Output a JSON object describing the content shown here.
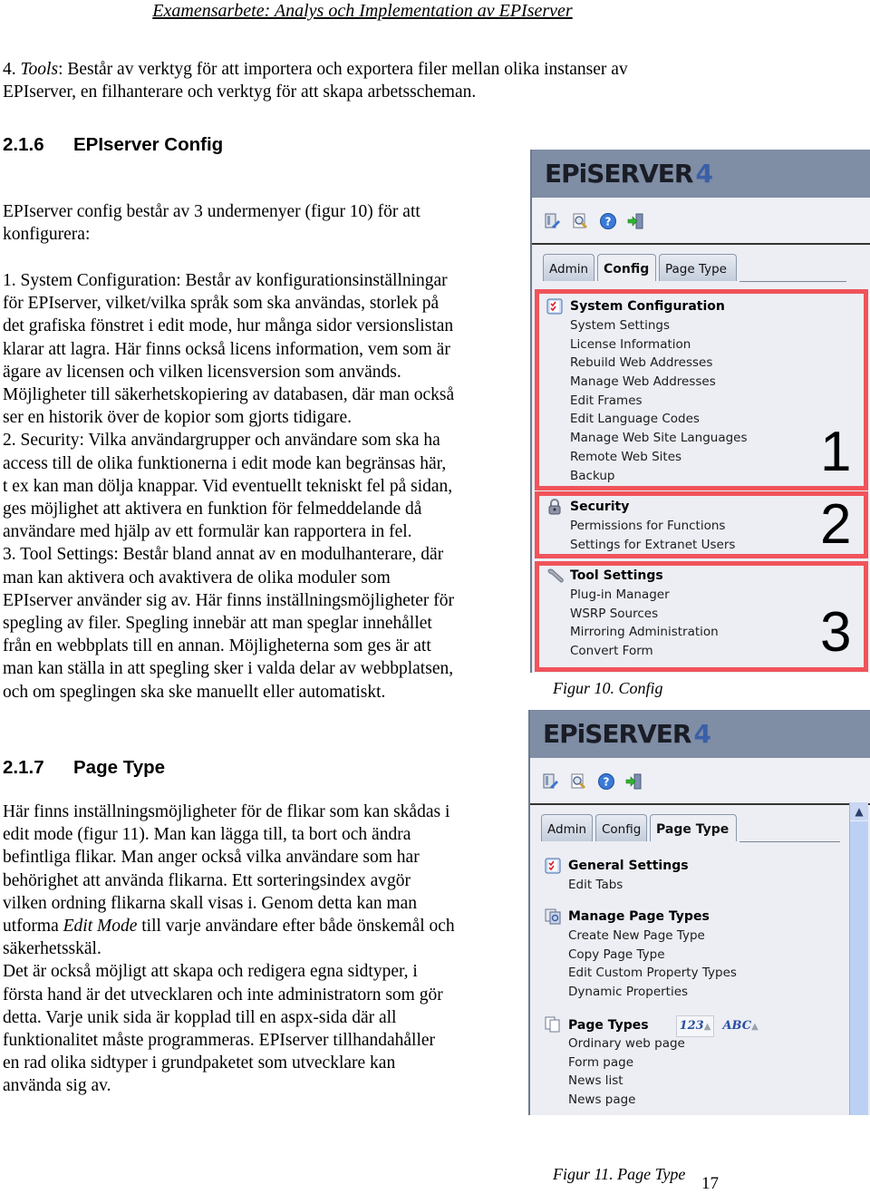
{
  "running_header": "Examensarbete: Analys och Implementation av EPIserver",
  "intro_paragraph": {
    "num": "4. ",
    "term": "Tools",
    "lines": [
      ": Består av verktyg för att importera och exportera filer mellan olika instanser av",
      "EPIserver, en filhanterare och verktyg för att skapa arbetsscheman."
    ]
  },
  "section_216": {
    "number": "2.1.6",
    "title": "EPIserver Config",
    "intro_lines": [
      "EPIserver config består av 3 undermenyer (figur 10) för att",
      "konfigurera:"
    ],
    "body_lines": [
      "1. System Configuration: Består av konfigurationsinställningar",
      "för EPIserver, vilket/vilka språk som ska användas, storlek på",
      "det grafiska fönstret i edit mode, hur många sidor versionslistan",
      "klarar att lagra. Här finns också licens information, vem som är",
      "ägare av licensen och vilken licensversion som används.",
      "Möjligheter till säkerhetskopiering av databasen, där man också",
      "ser en historik över de kopior som gjorts tidigare.",
      "2. Security: Vilka användargrupper och användare som ska ha",
      "access till de olika funktionerna i edit mode kan begränsas här,",
      "t ex kan man dölja knappar. Vid eventuellt tekniskt fel på sidan,",
      "ges möjlighet att aktivera en funktion för felmeddelande då",
      "användare med hjälp av ett formulär kan rapportera in fel.",
      "3. Tool Settings: Består bland annat av en modulhanterare, där",
      "man kan aktivera och avaktivera de olika moduler som",
      "EPIserver använder sig av. Här finns inställningsmöjligheter för",
      "spegling av filer. Spegling innebär att man speglar innehållet",
      "från en webbplats till en annan. Möjligheterna som ges är att",
      "man kan ställa in att spegling sker i valda delar av webbplatsen,",
      "och om speglingen ska ske manuellt eller automatiskt."
    ]
  },
  "section_217": {
    "number": "2.1.7",
    "title": "Page Type",
    "lines": [
      {
        "text": "Här finns inställningsmöjligheter för de flikar som kan skådas i"
      },
      {
        "text": "edit mode (figur 11). Man kan lägga till, ta bort och ändra"
      },
      {
        "text": "befintliga flikar. Man anger också vilka användare som har"
      },
      {
        "text": "behörighet att använda flikarna. Ett sorteringsindex avgör"
      },
      {
        "text": "vilken ordning flikarna skall visas i. Genom detta kan man"
      },
      {
        "pre": "utforma ",
        "em": "Edit Mode",
        "post": " till varje användare efter både önskemål och"
      },
      {
        "text": "säkerhetsskäl."
      },
      {
        "text": "Det är också möjligt att skapa och redigera egna sidtyper, i"
      },
      {
        "text": "första hand är det utvecklaren och inte administratorn som gör"
      },
      {
        "text": "detta. Varje unik sida är kopplad till en aspx-sida där all"
      },
      {
        "text": "funktionalitet måste programmeras. EPIserver tillhandahåller"
      },
      {
        "text": "en rad olika sidtyper i grundpaketet som utvecklare kan"
      },
      {
        "text": "använda sig av."
      }
    ]
  },
  "figure10": {
    "logo_text": "EPiSERVER",
    "logo_version": "4",
    "toolbar_icons": [
      "edit-mode-icon",
      "preview-icon",
      "help-icon",
      "logout-icon"
    ],
    "tabs": [
      {
        "label": "Admin",
        "active": false
      },
      {
        "label": "Config",
        "active": true
      },
      {
        "label": "Page Type",
        "active": false
      }
    ],
    "groups": [
      {
        "icon": "checklist-icon",
        "title": "System Configuration",
        "number": "1",
        "items": [
          "System Settings",
          "License Information",
          "Rebuild Web Addresses",
          "Manage Web Addresses",
          "Edit Frames",
          "Edit Language Codes",
          "Manage Web Site Languages",
          "Remote Web Sites",
          "Backup"
        ]
      },
      {
        "icon": "padlock-icon",
        "title": "Security",
        "number": "2",
        "items": [
          "Permissions for Functions",
          "Settings for Extranet Users"
        ]
      },
      {
        "icon": "wrench-icon",
        "title": "Tool Settings",
        "number": "3",
        "items": [
          "Plug-in Manager",
          "WSRP Sources",
          "Mirroring Administration",
          "Convert Form"
        ]
      }
    ],
    "highlight_color": "#f0535b",
    "caption": "Figur 10. Config"
  },
  "figure11": {
    "logo_text": "EPiSERVER",
    "logo_version": "4",
    "toolbar_icons": [
      "edit-mode-icon",
      "preview-icon",
      "help-icon",
      "logout-icon"
    ],
    "tabs": [
      {
        "label": "Admin",
        "active": false
      },
      {
        "label": "Config",
        "active": false
      },
      {
        "label": "Page Type",
        "active": true
      }
    ],
    "groups": [
      {
        "icon": "checklist-icon",
        "title": "General Settings",
        "items": [
          "Edit Tabs"
        ]
      },
      {
        "icon": "page-types-manage-icon",
        "title": "Manage Page Types",
        "items": [
          "Create New Page Type",
          "Copy Page Type",
          "Edit Custom Property Types",
          "Dynamic Properties"
        ]
      },
      {
        "icon": "pages-icon",
        "title": "Page Types",
        "sort_numeric": "123",
        "sort_alpha": "ABC",
        "sort_arrow": "▲",
        "items": [
          "Ordinary web page",
          "Form page",
          "News list",
          "News page"
        ]
      }
    ],
    "scroll_up": "^",
    "caption": "Figur 11. Page Type"
  },
  "page_number": "17"
}
